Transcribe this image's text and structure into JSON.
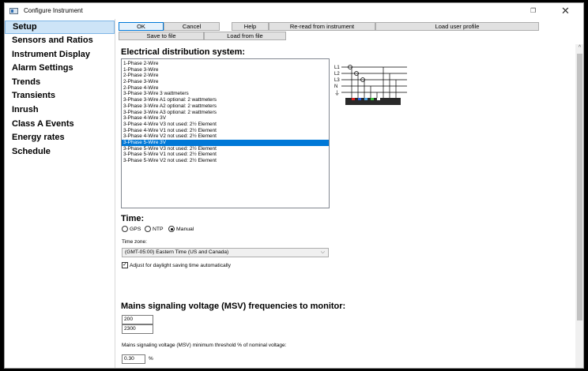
{
  "window": {
    "title": "Configure Instrument",
    "close": "✕",
    "restore": "❐"
  },
  "sidebar": {
    "items": [
      {
        "label": "Setup",
        "active": true
      },
      {
        "label": "Sensors and Ratios"
      },
      {
        "label": "Instrument Display"
      },
      {
        "label": "Alarm Settings"
      },
      {
        "label": "Trends"
      },
      {
        "label": "Transients"
      },
      {
        "label": "Inrush"
      },
      {
        "label": "Class A Events"
      },
      {
        "label": "Energy rates"
      },
      {
        "label": "Schedule"
      }
    ]
  },
  "toolbar": {
    "ok": "OK",
    "cancel": "Cancel",
    "help": "Help",
    "reread": "Re-read from instrument",
    "load_profile": "Load user profile",
    "save_file": "Save to file",
    "load_file": "Load from file"
  },
  "distribution": {
    "title": "Electrical distribution system:",
    "items": [
      "1-Phase 2-Wire",
      "1-Phase 3-Wire",
      "2-Phase 2-Wire",
      "2-Phase 3-Wire",
      "2-Phase 4-Wire",
      "3-Phase 3-Wire 3 wattmeters",
      "3-Phase 3-Wire A1 optional: 2 wattmeters",
      "3-Phase 3-Wire A2 optional: 2 wattmeters",
      "3-Phase 3-Wire A3 optional: 2 wattmeters",
      "3-Phase 4-Wire 3V",
      "3-Phase 4-Wire V3 not used: 2½ Element",
      "3-Phase 4-Wire V1 not used: 2½ Element",
      "3-Phase 4-Wire V2 not used: 2½ Element",
      "3-Phase 5-Wire 3V",
      "3-Phase 5-Wire V3 not used: 2½ Element",
      "3-Phase 5-Wire V1 not used: 2½ Element",
      "3-Phase 5-Wire V2 not used: 2½ Element"
    ],
    "selected_index": 13,
    "diagram": {
      "l1": "L1",
      "l2": "L2",
      "l3": "L3",
      "n": "N",
      "ground": "⏚"
    }
  },
  "time": {
    "title": "Time:",
    "options": [
      "GPS",
      "NTP",
      "Manual"
    ],
    "selected": "Manual",
    "zone_label": "Time zone:",
    "zone_value": "(GMT-05:00) Eastern Time (US and Canada)",
    "dst_label": "Adjust for daylight saving time automatically",
    "dst_checked": true
  },
  "msv": {
    "title": "Mains signaling voltage (MSV) frequencies to monitor:",
    "freq1": "200",
    "freq2": "2300",
    "threshold_label": "Mains signaling voltage (MSV) minimum threshold % of nominal voltage:",
    "threshold_value": "0.30",
    "threshold_unit": "%"
  },
  "colors": {
    "accent": "#0078d7",
    "active_nav": "#cde4f7"
  }
}
